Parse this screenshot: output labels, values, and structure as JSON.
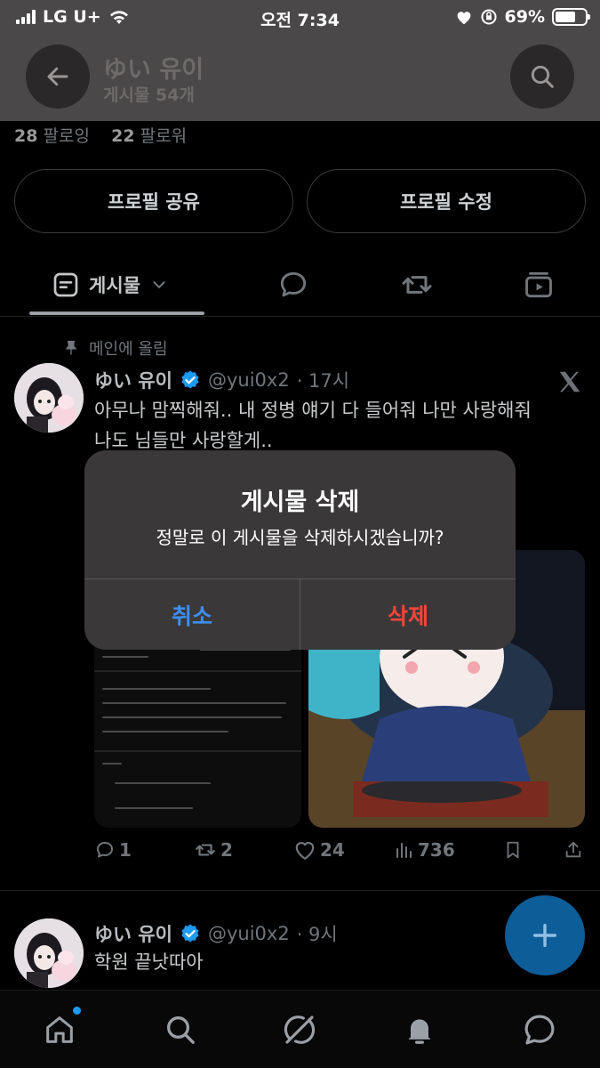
{
  "status": {
    "carrier": "LG U+",
    "time": "오전 7:34",
    "battery": "69%",
    "battery_level": 0.69
  },
  "header": {
    "name": "ゆい 유이",
    "post_count": "게시물 54개"
  },
  "profile": {
    "following_count": "28",
    "following_label": "팔로잉",
    "followers_count": "22",
    "followers_label": "팔로워",
    "share_button": "프로필 공유",
    "edit_button": "프로필 수정"
  },
  "tabs": {
    "posts_label": "게시물"
  },
  "pinned_label": "메인에 올림",
  "posts": [
    {
      "name": "ゆい 유이",
      "handle": "@yui0x2",
      "time": "· 17시",
      "text_line1": "아무나 맘찍해줘.. 내 정병 얘기 다 들어줘 나만 사랑해줘",
      "text_line2": "나도 님들만 사랑할게..",
      "replies": "1",
      "reposts": "2",
      "likes": "24",
      "views": "736"
    },
    {
      "name": "ゆい 유이",
      "handle": "@yui0x2",
      "time": "· 9시",
      "text": "학원 끝낫따아"
    }
  ],
  "dialog": {
    "title": "게시물 삭제",
    "message": "정말로 이 게시물을 삭제하시겠습니까?",
    "cancel": "취소",
    "delete": "삭제"
  },
  "colors": {
    "accent_blue": "#1d9bf0",
    "cancel_blue": "#3e8ef7",
    "delete_red": "#ff453a",
    "verified": "#1d9bf0"
  },
  "icons": {
    "back": "arrow-left-icon",
    "search": "search-icon",
    "reply": "speech-bubble-icon",
    "repost": "repost-icon",
    "like": "heart-icon",
    "views": "bar-chart-icon",
    "bookmark": "bookmark-icon",
    "share": "share-icon",
    "compose": "plus-icon",
    "home": "home-icon",
    "grok": "grok-icon",
    "notifications": "bell-icon",
    "messages": "message-bubble-icon"
  }
}
